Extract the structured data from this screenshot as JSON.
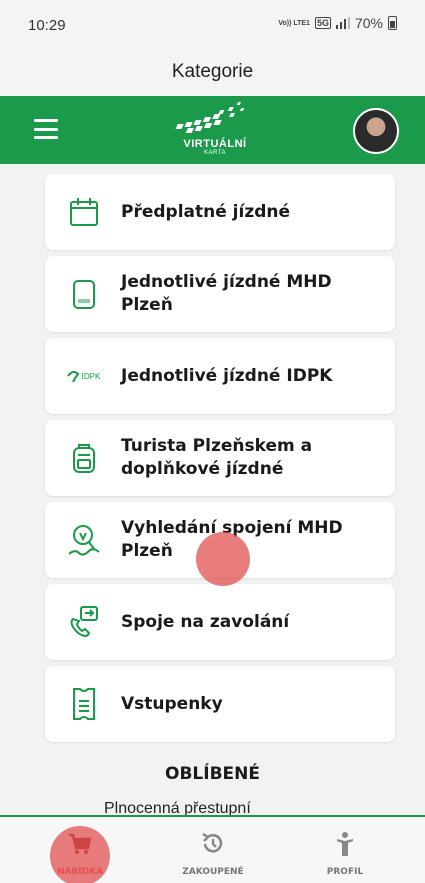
{
  "status_bar": {
    "time": "10:29",
    "volte": "Vo)) LTE1",
    "network": "5G",
    "battery": "70%"
  },
  "title": "Kategorie",
  "header": {
    "logo_text": "VIRTUÁLNÍ",
    "logo_sub": "KARTA"
  },
  "categories": [
    {
      "label": "Předplatné jízdné",
      "icon": "calendar-icon"
    },
    {
      "label": "Jednotlivé jízdné MHD Plzeň",
      "icon": "ticket-card-icon"
    },
    {
      "label": "Jednotlivé jízdné IDPK",
      "icon": "idpk-logo-icon",
      "icon_text": "IDPK"
    },
    {
      "label": "Turista Plzeňskem a doplňkové jízdné",
      "icon": "backpack-icon"
    },
    {
      "label": "Vyhledání spojení MHD Plzeň",
      "icon": "route-search-icon"
    },
    {
      "label": "Spoje na zavolání",
      "icon": "phone-call-icon"
    },
    {
      "label": "Vstupenky",
      "icon": "entry-ticket-icon"
    }
  ],
  "favorites": {
    "title": "OBLÍBENÉ",
    "items": [
      "Plnocenná přestupní"
    ]
  },
  "bottom_nav": [
    {
      "label": "NABÍDKA",
      "icon": "cart-icon",
      "active": true
    },
    {
      "label": "ZAKOUPENÉ",
      "icon": "history-icon",
      "active": false
    },
    {
      "label": "PROFIL",
      "icon": "person-icon",
      "active": false
    }
  ],
  "colors": {
    "brand_green": "#1a9a4a",
    "active_red": "#e65050",
    "background": "#f2f2f2",
    "icon_green": "#1a9a4a"
  }
}
